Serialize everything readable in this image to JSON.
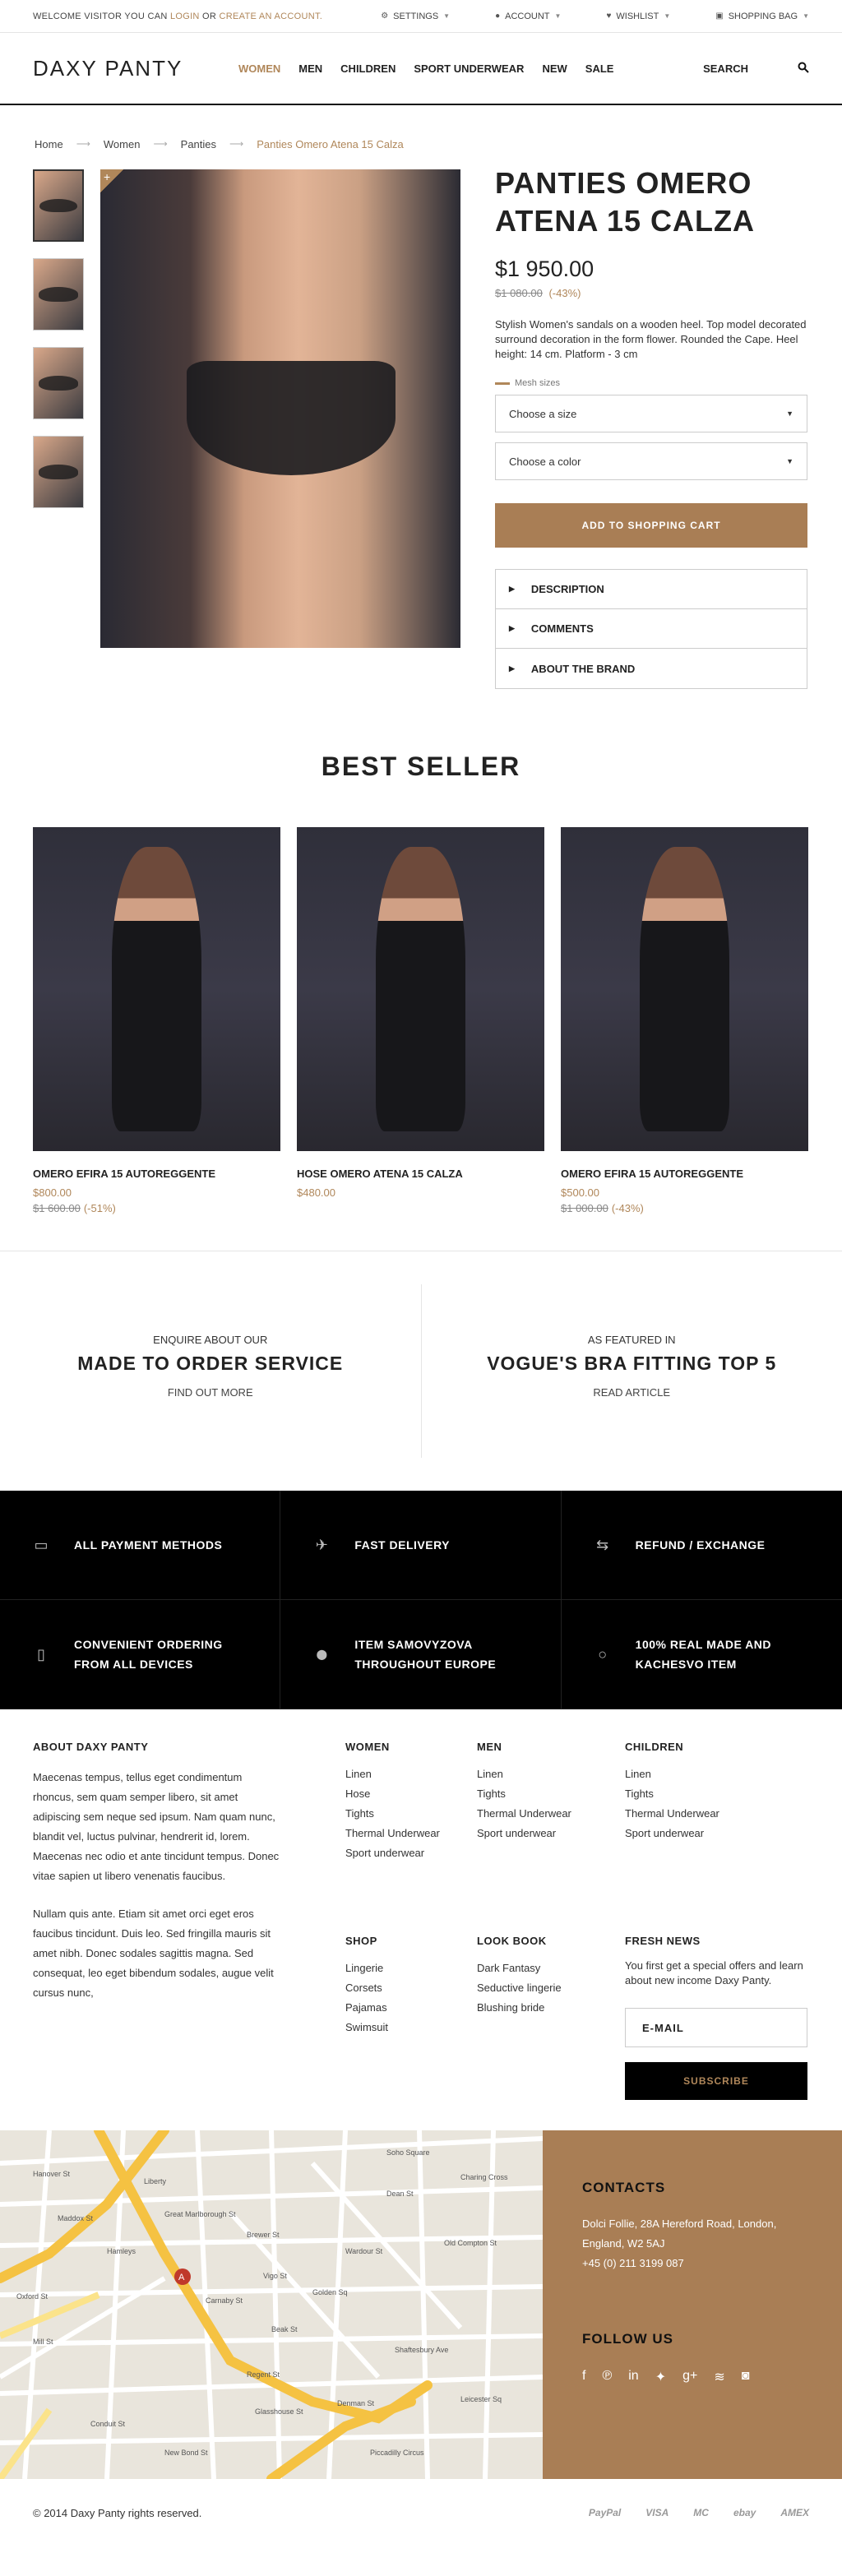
{
  "topbar": {
    "welcome_prefix": "WELCOME VISITOR YOU CAN",
    "login": "LOGIN",
    "or": "OR",
    "create": "CREATE AN ACCOUNT.",
    "settings": "SETTINGS",
    "account": "ACCOUNT",
    "wishlist": "WISHLIST",
    "bag": "SHOPPING BAG"
  },
  "header": {
    "logo": "DAXY PANTY",
    "nav": [
      "WOMEN",
      "MEN",
      "CHILDREN",
      "SPORT UNDERWEAR",
      "NEW",
      "SALE"
    ],
    "search": "SEARCH"
  },
  "breadcrumb": [
    "Home",
    "Women",
    "Panties",
    "Panties Omero Atena 15 Calza"
  ],
  "product": {
    "title": "PANTIES OMERO ATENA 15 CALZA",
    "price": "$1 950.00",
    "old_price": "$1 080.00",
    "discount": "(-43%)",
    "description": "Stylish Women's sandals on a wooden heel. Top model decorated surround decoration in the form flower. Rounded the Cape. Heel height: 14 cm. Platform - 3 cm",
    "sizes_label": "Mesh sizes",
    "size_placeholder": "Choose a size",
    "color_placeholder": "Choose a color",
    "cart_button": "ADD TO SHOPPING CART",
    "accordion": [
      "DESCRIPTION",
      "COMMENTS",
      "ABOUT THE BRAND"
    ]
  },
  "best_seller": {
    "title": "BEST SELLER",
    "items": [
      {
        "name": "OMERO EFIRA 15 AUTOREGGENTE",
        "price": "$800.00",
        "old": "$1 600.00",
        "discount": "(-51%)"
      },
      {
        "name": "HOSE OMERO ATENA 15 CALZA",
        "price": "$480.00",
        "old": "",
        "discount": ""
      },
      {
        "name": "OMERO EFIRA 15 AUTOREGGENTE",
        "price": "$500.00",
        "old": "$1 000.00",
        "discount": "(-43%)"
      }
    ]
  },
  "services": [
    {
      "pre": "ENQUIRE ABOUT OUR",
      "big": "MADE TO ORDER SERVICE",
      "link": "FIND OUT MORE"
    },
    {
      "pre": "AS FEATURED IN",
      "big": "VOGUE'S BRA FITTING TOP 5",
      "link": "READ ARTICLE"
    }
  ],
  "features": [
    {
      "icon": "credit-card-icon",
      "glyph": "▭",
      "text": "ALL PAYMENT METHODS"
    },
    {
      "icon": "airplane-icon",
      "glyph": "✈",
      "text": "FAST DELIVERY"
    },
    {
      "icon": "exchange-icon",
      "glyph": "⇆",
      "text": "REFUND / EXCHANGE"
    },
    {
      "icon": "mobile-icon",
      "glyph": "▯",
      "text": "CONVENIENT ORDERING FROM ALL DEVICES"
    },
    {
      "icon": "map-pin-icon",
      "glyph": "⬤",
      "text": "ITEM SAMOVYZOVA THROUGHOUT EUROPE"
    },
    {
      "icon": "circle-icon",
      "glyph": "○",
      "text": "100% REAL MADE AND KACHESVO ITEM"
    }
  ],
  "footer": {
    "about_title": "ABOUT DAXY PANTY",
    "about_p1": "Maecenas tempus, tellus eget condimentum rhoncus, sem quam semper libero, sit amet adipiscing sem neque sed ipsum. Nam quam nunc, blandit vel, luctus pulvinar, hendrerit id, lorem. Maecenas nec odio et ante tincidunt tempus. Donec vitae sapien ut libero venenatis faucibus.",
    "about_p2": "Nullam quis ante. Etiam sit amet orci eget eros faucibus tincidunt. Duis leo. Sed fringilla mauris sit amet nibh. Donec sodales sagittis magna. Sed consequat, leo eget bibendum sodales, augue velit cursus nunc,",
    "women_title": "WOMEN",
    "women": [
      "Linen",
      "Hose",
      "Tights",
      "Thermal Underwear",
      "Sport underwear"
    ],
    "men_title": "MEN",
    "men": [
      "Linen",
      "Tights",
      "Thermal Underwear",
      "Sport underwear"
    ],
    "children_title": "CHILDREN",
    "children": [
      "Linen",
      "Tights",
      "Thermal Underwear",
      "Sport underwear"
    ],
    "shop_title": "SHOP",
    "shop": [
      "Lingerie",
      "Corsets",
      "Pajamas",
      "Swimsuit"
    ],
    "lookbook_title": "LOOK BOOK",
    "lookbook": [
      "Dark Fantasy",
      "Seductive lingerie",
      "Blushing bride"
    ],
    "news_title": "FRESH NEWS",
    "news_text": "You first get a special offers and learn about new income Daxy Panty.",
    "email_placeholder": "E-MAIL",
    "subscribe": "SUBSCRIBE"
  },
  "contacts": {
    "title": "CONTACTS",
    "address": "Dolci Follie, 28A Hereford Road, London, England, W2 5AJ",
    "phone": "+45 (0) 211 3199 087",
    "follow": "FOLLOW US",
    "social": [
      {
        "icon": "facebook-icon",
        "glyph": "f"
      },
      {
        "icon": "pinterest-icon",
        "glyph": "℗"
      },
      {
        "icon": "linkedin-icon",
        "glyph": "in"
      },
      {
        "icon": "twitter-icon",
        "glyph": "✦"
      },
      {
        "icon": "google-plus-icon",
        "glyph": "g+"
      },
      {
        "icon": "rss-icon",
        "glyph": "≋"
      },
      {
        "icon": "instagram-icon",
        "glyph": "◙"
      }
    ]
  },
  "map": {
    "streets": [
      "Hanover St",
      "Regent St",
      "Oxford St",
      "Brewer St",
      "Dean St",
      "Wardour St",
      "Piccadilly Circus",
      "Old Compton St",
      "Charing Cross",
      "Soho Square",
      "Great Marlborough St",
      "Carnaby St",
      "Beak St",
      "Glasshouse St",
      "Denman St",
      "Shaftesbury Ave",
      "Leicester Sq",
      "Golden Sq",
      "Conduit St",
      "Maddox St",
      "Mill St",
      "Vigo St",
      "New Bond St",
      "Hamleys",
      "Liberty"
    ]
  },
  "bottom": {
    "copyright": "© 2014 Daxy Panty rights reserved.",
    "payments": [
      "PayPal",
      "VISA",
      "MC",
      "ebay",
      "AMEX"
    ]
  },
  "colors": {
    "accent": "#b0875a",
    "button": "#a97e55",
    "dark": "#000000"
  }
}
